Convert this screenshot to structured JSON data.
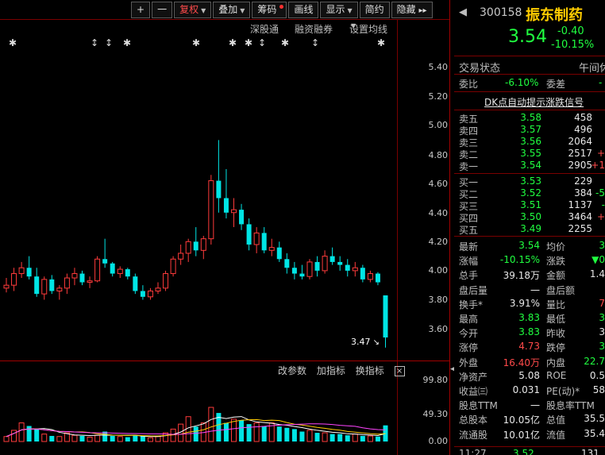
{
  "toolbar": {
    "plus": "+",
    "minus": "一",
    "fq": "复权",
    "overlay": "叠加",
    "chips": "筹码",
    "draw": "画线",
    "display": "显示",
    "brief": "简约",
    "hide": "隐藏",
    "expand": "▸▸"
  },
  "subbar": {
    "shengutong": "深股通",
    "margin": "融资融券",
    "ma_setting": "设置均线"
  },
  "price_axis": [
    "5.40",
    "5.20",
    "5.00",
    "4.80",
    "4.60",
    "4.40",
    "4.20",
    "4.00",
    "3.80",
    "3.60"
  ],
  "current_low_label": "3.47",
  "volume_axis": [
    "99.80",
    "49.30",
    "0.00"
  ],
  "indicator_bar": {
    "modify": "改参数",
    "add": "加指标",
    "switch": "换指标",
    "close": "×"
  },
  "quote": {
    "code": "300158",
    "name": "振东制药",
    "price": "3.54",
    "change": "-0.40",
    "change_pct": "-10.15%"
  },
  "status": {
    "label": "交易状态",
    "value": "午间休"
  },
  "ratio": {
    "wb_label": "委比",
    "wb_value": "-6.10%",
    "wc_label": "委差",
    "wc_value": "-"
  },
  "dk_link": "DK点自动提示涨跌信号",
  "sells": [
    {
      "label": "卖五",
      "price": "3.58",
      "vol": "458"
    },
    {
      "label": "卖四",
      "price": "3.57",
      "vol": "496"
    },
    {
      "label": "卖三",
      "price": "3.56",
      "vol": "2064"
    },
    {
      "label": "卖二",
      "price": "3.55",
      "vol": "2517",
      "chg": "+"
    },
    {
      "label": "卖一",
      "price": "3.54",
      "vol": "2905",
      "chg": "+1"
    }
  ],
  "buys": [
    {
      "label": "买一",
      "price": "3.53",
      "vol": "229",
      "chg": ""
    },
    {
      "label": "买二",
      "price": "3.52",
      "vol": "384",
      "chg": "-5"
    },
    {
      "label": "买三",
      "price": "3.51",
      "vol": "1137",
      "chg": "-"
    },
    {
      "label": "买四",
      "price": "3.50",
      "vol": "3464",
      "chg": "+"
    },
    {
      "label": "买五",
      "price": "3.49",
      "vol": "2255",
      "chg": ""
    }
  ],
  "stats": [
    {
      "l1": "最新",
      "v1": "3.54",
      "c1": "green",
      "l2": "均价",
      "v2": "3",
      "c2": "green"
    },
    {
      "l1": "涨幅",
      "v1": "-10.15%",
      "c1": "green",
      "l2": "涨跌",
      "v2": "▼0",
      "c2": "green"
    },
    {
      "l1": "总手",
      "v1": "39.18万",
      "c1": "white",
      "l2": "金额",
      "v2": "1.4",
      "c2": "white"
    },
    {
      "l1": "盘后量",
      "v1": "一",
      "c1": "white",
      "l2": "盘后额",
      "v2": "",
      "c2": "white"
    },
    {
      "l1": "换手*",
      "v1": "3.91%",
      "c1": "white",
      "l2": "量比",
      "v2": "7",
      "c2": "red"
    },
    {
      "l1": "最高",
      "v1": "3.83",
      "c1": "green",
      "l2": "最低",
      "v2": "3",
      "c2": "green"
    },
    {
      "l1": "今开",
      "v1": "3.83",
      "c1": "green",
      "l2": "昨收",
      "v2": "3",
      "c2": "white"
    },
    {
      "l1": "涨停",
      "v1": "4.73",
      "c1": "red",
      "l2": "跌停",
      "v2": "3",
      "c2": "green"
    },
    {
      "l1": "外盘",
      "v1": "16.40万",
      "c1": "red",
      "l2": "内盘",
      "v2": "22.7",
      "c2": "green"
    },
    {
      "l1": "净资产",
      "v1": "5.08",
      "c1": "white",
      "l2": "ROE",
      "v2": "0.5",
      "c2": "white"
    },
    {
      "l1": "收益㈢",
      "v1": "0.031",
      "c1": "white",
      "l2": "PE(动)*",
      "v2": "58",
      "c2": "white"
    },
    {
      "l1": "股息TTM",
      "v1": "一",
      "c1": "white",
      "l2": "股息率TTM",
      "v2": "",
      "c2": "white"
    },
    {
      "l1": "总股本",
      "v1": "10.05亿",
      "c1": "white",
      "l2": "总值",
      "v2": "35.5",
      "c2": "white"
    },
    {
      "l1": "流通股",
      "v1": "10.01亿",
      "c1": "white",
      "l2": "流值",
      "v2": "35.4",
      "c2": "white"
    }
  ],
  "tick": {
    "time": "11:27",
    "price": "3.52",
    "vol": "131"
  },
  "chart_data": {
    "type": "candlestick",
    "ylim": [
      3.47,
      5.48
    ],
    "y_ticks": [
      5.4,
      5.2,
      5.0,
      4.8,
      4.6,
      4.4,
      4.2,
      4.0,
      3.8,
      3.6
    ],
    "volume_ylim": [
      0,
      99.8
    ],
    "ohlc": [
      [
        3.88,
        3.95,
        3.85,
        3.9
      ],
      [
        3.9,
        4.02,
        3.86,
        3.98
      ],
      [
        3.98,
        4.06,
        3.95,
        4.02
      ],
      [
        4.02,
        4.1,
        3.94,
        3.96
      ],
      [
        3.96,
        4.02,
        3.82,
        3.84
      ],
      [
        3.84,
        3.96,
        3.8,
        3.94
      ],
      [
        3.94,
        3.97,
        3.84,
        3.86
      ],
      [
        3.86,
        3.9,
        3.8,
        3.88
      ],
      [
        3.88,
        3.98,
        3.84,
        3.95
      ],
      [
        3.95,
        4.02,
        3.9,
        3.98
      ],
      [
        3.98,
        4.0,
        3.9,
        3.92
      ],
      [
        3.92,
        3.96,
        3.88,
        3.93
      ],
      [
        3.93,
        4.1,
        3.92,
        4.08
      ],
      [
        4.08,
        4.22,
        4.02,
        4.05
      ],
      [
        4.05,
        4.06,
        3.96,
        3.98
      ],
      [
        3.98,
        4.03,
        3.95,
        4.01
      ],
      [
        4.01,
        4.02,
        3.94,
        3.96
      ],
      [
        3.96,
        3.98,
        3.84,
        3.86
      ],
      [
        3.86,
        3.9,
        3.8,
        3.82
      ],
      [
        3.82,
        3.88,
        3.8,
        3.86
      ],
      [
        3.86,
        3.92,
        3.84,
        3.88
      ],
      [
        3.88,
        4.0,
        3.86,
        3.98
      ],
      [
        3.98,
        4.1,
        3.96,
        4.08
      ],
      [
        4.08,
        4.18,
        4.04,
        4.12
      ],
      [
        4.12,
        4.22,
        4.06,
        4.2
      ],
      [
        4.2,
        4.3,
        4.1,
        4.14
      ],
      [
        4.14,
        4.24,
        4.08,
        4.22
      ],
      [
        4.22,
        4.66,
        4.18,
        4.62
      ],
      [
        4.62,
        4.9,
        4.4,
        4.5
      ],
      [
        4.5,
        4.7,
        4.36,
        4.4
      ],
      [
        4.4,
        4.5,
        4.3,
        4.42
      ],
      [
        4.42,
        4.46,
        4.28,
        4.32
      ],
      [
        4.32,
        4.36,
        4.14,
        4.18
      ],
      [
        4.18,
        4.3,
        4.12,
        4.26
      ],
      [
        4.26,
        4.3,
        4.12,
        4.14
      ],
      [
        4.14,
        4.22,
        4.1,
        4.16
      ],
      [
        4.16,
        4.2,
        4.06,
        4.08
      ],
      [
        4.08,
        4.12,
        3.98,
        4.02
      ],
      [
        4.02,
        4.06,
        3.94,
        3.98
      ],
      [
        3.98,
        4.04,
        3.94,
        3.96
      ],
      [
        3.96,
        4.08,
        3.94,
        4.06
      ],
      [
        4.06,
        4.1,
        3.96,
        4.0
      ],
      [
        4.0,
        4.14,
        3.98,
        4.1
      ],
      [
        4.1,
        4.16,
        4.04,
        4.06
      ],
      [
        4.06,
        4.1,
        4.0,
        4.04
      ],
      [
        4.04,
        4.08,
        3.96,
        4.0
      ],
      [
        4.0,
        4.06,
        3.96,
        4.02
      ],
      [
        4.02,
        4.04,
        3.92,
        3.94
      ],
      [
        3.94,
        4.0,
        3.92,
        3.98
      ],
      [
        3.98,
        3.99,
        3.9,
        3.92
      ],
      [
        3.83,
        3.83,
        3.47,
        3.54
      ]
    ],
    "volume": [
      8,
      18,
      30,
      25,
      20,
      12,
      9,
      8,
      14,
      10,
      9,
      7,
      10,
      16,
      9,
      8,
      7,
      10,
      9,
      6,
      8,
      14,
      20,
      28,
      40,
      24,
      30,
      55,
      46,
      30,
      36,
      34,
      28,
      30,
      25,
      30,
      24,
      22,
      20,
      16,
      18,
      14,
      14,
      12,
      12,
      10,
      12,
      9,
      9,
      8,
      26
    ]
  }
}
